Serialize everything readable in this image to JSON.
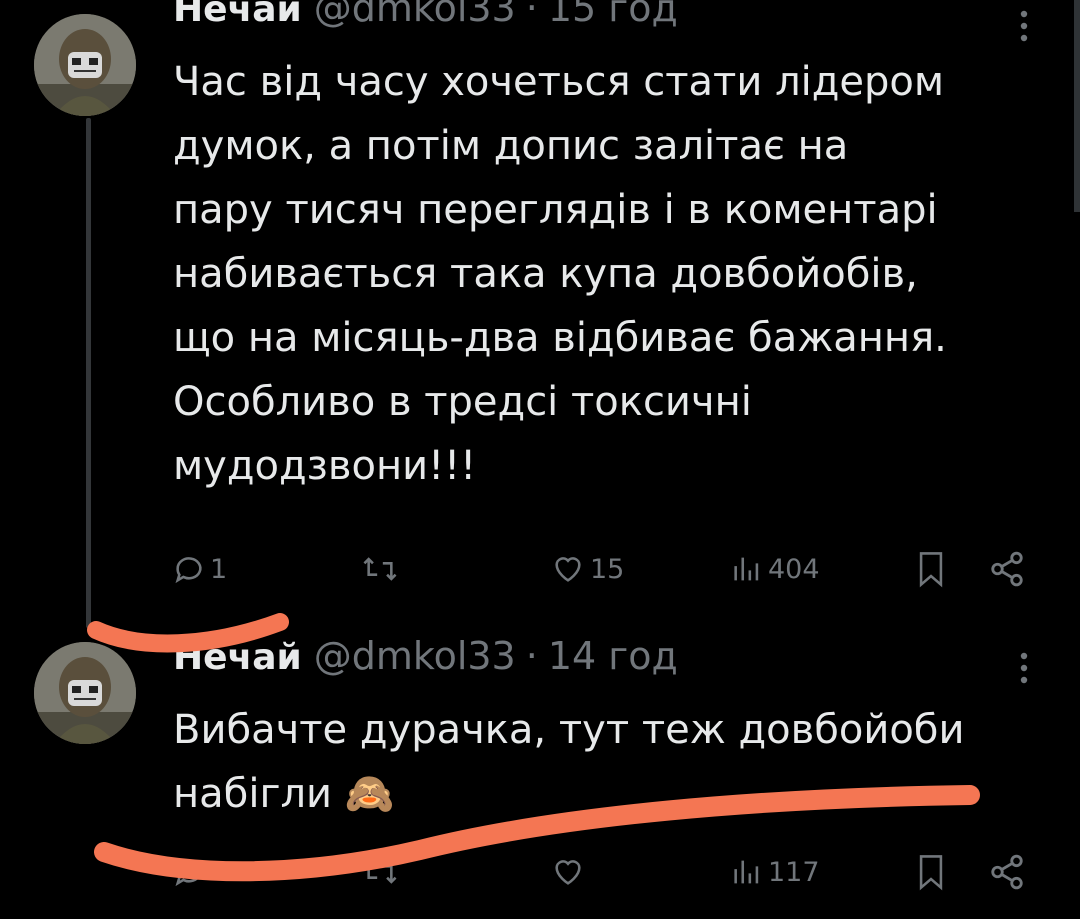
{
  "colors": {
    "background": "#000000",
    "text": "#e7e9ea",
    "muted": "#71767b",
    "scribble": "#f47653"
  },
  "tweets": [
    {
      "name": "Нечай",
      "handle": "@dmkol33",
      "separator": "·",
      "time": "15 год",
      "text": "Час від часу хочеться стати лідером\nдумок, а потім допис залітає на\nпару тисяч переглядів і в коментарі\nнабивається така купа довбойобів,\nщо на місяць-два відбиває бажання.\nОсобливо в тредсі токсичні\nмудодзвони!!!",
      "replies": "1",
      "reposts": "",
      "likes": "15",
      "views": "404",
      "icons": [
        "reply-icon",
        "repost-icon",
        "heart-icon",
        "views-icon",
        "bookmark-icon",
        "share-icon",
        "more-icon"
      ]
    },
    {
      "name": "Нечай",
      "handle": "@dmkol33",
      "separator": "·",
      "time": "14 год",
      "text": "Вибачте дурачка, тут теж довбойоби\nнабігли 🙈",
      "replies": "",
      "reposts": "",
      "likes": "",
      "views": "117",
      "icons": [
        "reply-icon",
        "repost-icon",
        "heart-icon",
        "views-icon",
        "bookmark-icon",
        "share-icon",
        "more-icon"
      ]
    }
  ]
}
